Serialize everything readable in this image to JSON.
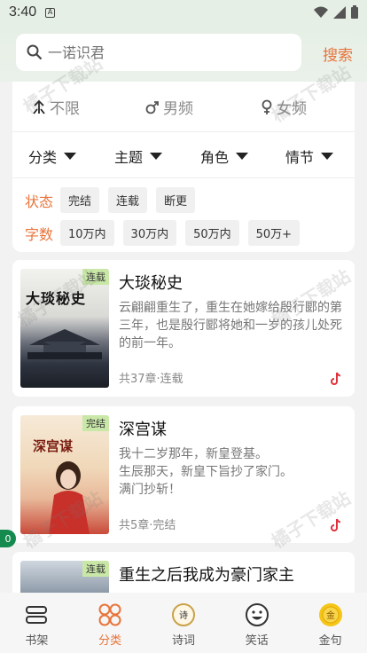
{
  "status": {
    "time": "3:40"
  },
  "search": {
    "placeholder": "一诺识君",
    "button_label": "搜索"
  },
  "gender_tabs": [
    {
      "label": "不限",
      "icon": "unlimited-icon"
    },
    {
      "label": "男频",
      "icon": "male-icon"
    },
    {
      "label": "女频",
      "icon": "female-icon"
    }
  ],
  "category_filters": [
    {
      "label": "分类"
    },
    {
      "label": "主题"
    },
    {
      "label": "角色"
    },
    {
      "label": "情节"
    }
  ],
  "status_filter": {
    "label": "状态",
    "options": [
      "完结",
      "连载",
      "断更"
    ]
  },
  "wordcount_filter": {
    "label": "字数",
    "options": [
      "10万内",
      "30万内",
      "50万内",
      "50万+"
    ]
  },
  "books": [
    {
      "title": "大琰秘史",
      "tag": "连载",
      "cover_text": "大琰秘史",
      "description": "云翩翩重生了，重生在她嫁给殷行郾的第三年，也是殷行郾将她和一岁的孩儿处死的前一年。",
      "meta": "共37章·连载"
    },
    {
      "title": "深宫谋",
      "tag": "完结",
      "cover_text": "深宫谋",
      "description": "我十二岁那年，新皇登基。\n生辰那天，新皇下旨抄了家门。\n满门抄斩！",
      "meta": "共5章·完结"
    },
    {
      "title": "重生之后我成为豪门家主",
      "tag": "连载",
      "description": "",
      "meta": ""
    }
  ],
  "floating_badge": "0",
  "watermark_text": "橘子下载站",
  "bottom_nav": [
    {
      "label": "书架",
      "icon": "bookshelf-icon"
    },
    {
      "label": "分类",
      "icon": "category-icon",
      "active": true
    },
    {
      "label": "诗词",
      "icon": "poetry-icon"
    },
    {
      "label": "笑话",
      "icon": "joke-icon"
    },
    {
      "label": "金句",
      "icon": "golden-quote-icon"
    }
  ],
  "colors": {
    "accent": "#e8743b",
    "tag_bg": "#c9e8a8",
    "badge": "#148a4e",
    "header_bg": "#e6efe6"
  }
}
